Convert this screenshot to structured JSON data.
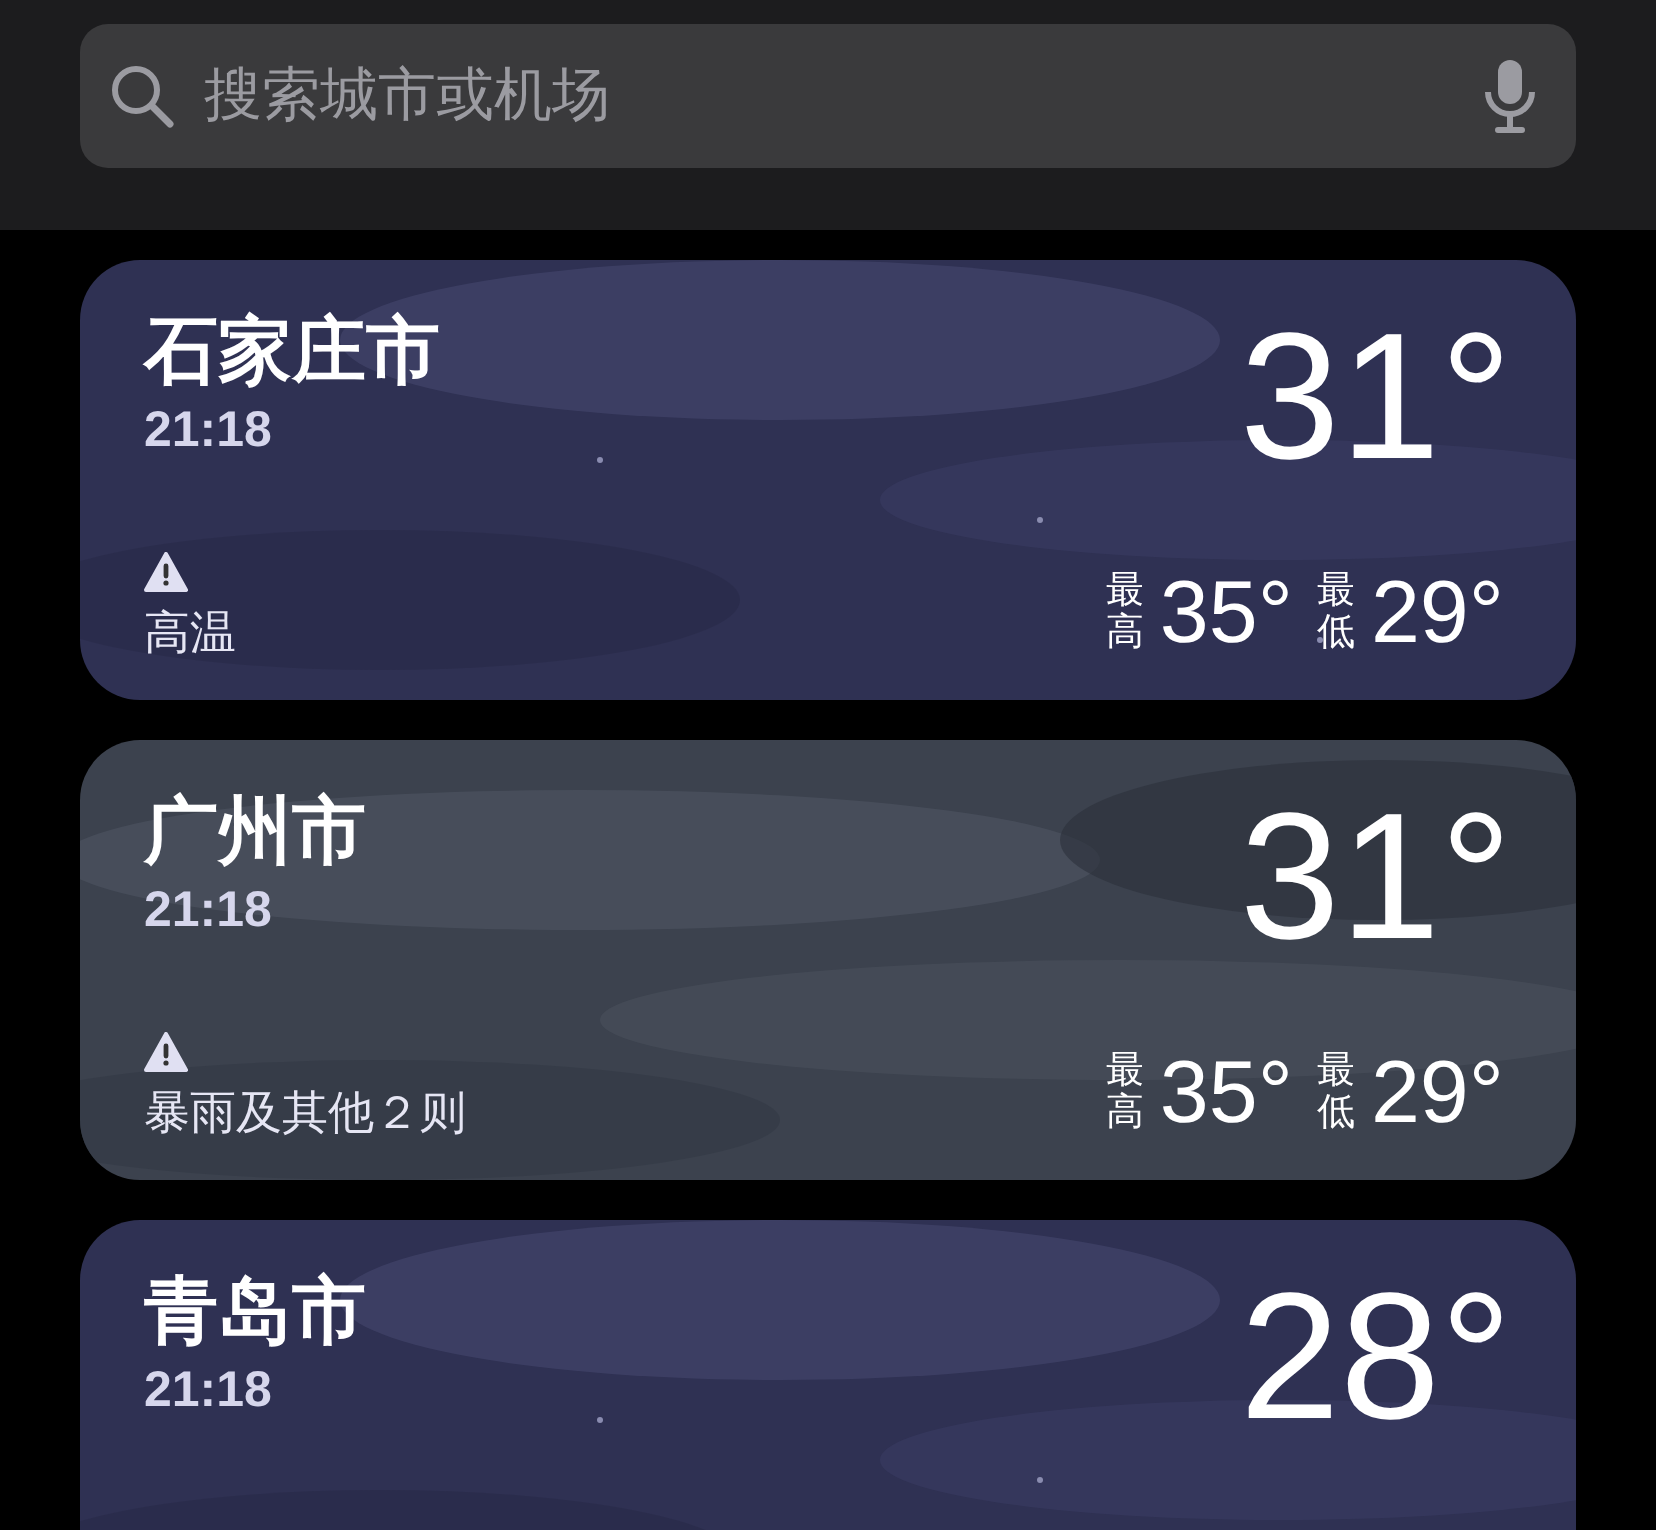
{
  "search": {
    "placeholder": "搜索城市或机场"
  },
  "cities": [
    {
      "name": "石家庄市",
      "time": "21:18",
      "temp": "31°",
      "kind": "night",
      "alert": "高温",
      "high_label": "最高",
      "high": "35°",
      "low_label": "最低",
      "low": "29°"
    },
    {
      "name": "广州市",
      "time": "21:18",
      "temp": "31°",
      "kind": "cloudy",
      "alert": "暴雨及其他２则",
      "high_label": "最高",
      "high": "35°",
      "low_label": "最低",
      "low": "29°"
    },
    {
      "name": "青岛市",
      "time": "21:18",
      "temp": "28°",
      "kind": "night"
    }
  ]
}
